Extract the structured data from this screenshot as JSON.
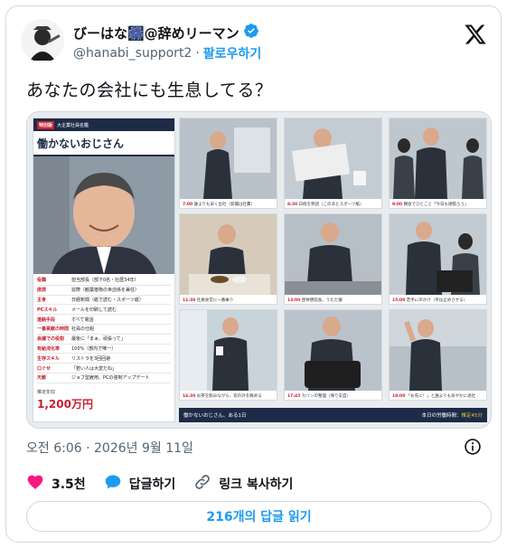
{
  "author": {
    "display_name": "びーはな🎆@辞めリーマン",
    "handle": "@hanabi_support2",
    "separator": "·",
    "follow_label": "팔로우하기"
  },
  "tweet": {
    "text": "あなたの会社にも生息してる？",
    "timestamp": "오전 6:06 · 2026년 9월 11일"
  },
  "infographic": {
    "badge": "特別版",
    "subtitle": "大企業社員名鑑",
    "title": "働かないおじさん",
    "profile": [
      {
        "key": "役職",
        "value": "担当部長（部下0名・社歴34年）"
      },
      {
        "key": "席席",
        "value": "窓際（観葉植物の世話係を兼任）"
      },
      {
        "key": "主食",
        "value": "日経新聞（紙で読む・スポーツ紙）"
      },
      {
        "key": "PCスキル",
        "value": "メールを印刷して読む"
      },
      {
        "key": "連絡手段",
        "value": "すべて電話"
      },
      {
        "key": "一番貢献の時間",
        "value": "社員の仕組"
      },
      {
        "key": "会議での役割",
        "value": "最後に「まぁ、頑張って」"
      },
      {
        "key": "有給消化率",
        "value": "100%（部内で唯一）"
      },
      {
        "key": "生存スキル",
        "value": "リストラを3回回避"
      },
      {
        "key": "口ぐせ",
        "value": "「若い人は大変だね」"
      },
      {
        "key": "天敵",
        "value": "ジョブ型雇用、PCの強制アップデート"
      }
    ],
    "pay_label": "推定年収",
    "pay_value": "1,200万円",
    "schedule": [
      {
        "time": "7:00",
        "text": "誰よりも早く出社（新聞は社費）"
      },
      {
        "time": "8:30",
        "text": "日経を熟読（このあとスポーツ紙）"
      },
      {
        "time": "9:00",
        "text": "朝会でひとこと「今日も頑張ろう」"
      },
      {
        "time": "11:30",
        "text": "社員食堂に一番乗り"
      },
      {
        "time": "13:00",
        "text": "昼休憩延長、うたた寝"
      },
      {
        "time": "15:00",
        "text": "若手に声かけ（手は止めさせる）"
      },
      {
        "time": "16:30",
        "text": "お茶を飲みながら、窓の外を眺める"
      },
      {
        "time": "17:45",
        "text": "カバンの整理（帰り支度）"
      },
      {
        "time": "18:00",
        "text": "「お先に！」と誰よりも早やかに退社"
      }
    ],
    "footer_left": "働かないおじさん、ある1日",
    "footer_right_label": "本日の労働時間：",
    "footer_right_value": "推定45分"
  },
  "actions": {
    "like_count": "3.5천",
    "reply_label": "답글하기",
    "copy_link_label": "링크 복사하기"
  },
  "read_replies_label": "216개의 답글 읽기",
  "colors": {
    "accent": "#1d9bf0",
    "like": "#f91880",
    "navy": "#1d2b48",
    "red": "#c8202f"
  },
  "icons": {
    "verified": "verified-badge-icon",
    "x_logo": "x-logo-icon",
    "info": "info-icon",
    "like": "heart-icon",
    "reply": "comment-bubble-icon",
    "link": "link-icon"
  }
}
